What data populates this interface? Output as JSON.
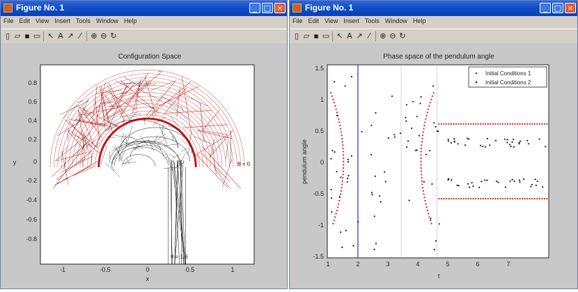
{
  "windows": [
    {
      "title": "Figure No. 1",
      "menu": [
        "File",
        "Edit",
        "View",
        "Insert",
        "Tools",
        "Window",
        "Help"
      ],
      "plot": {
        "title": "Configuration Space",
        "xlabel": "x",
        "ylabel": "y",
        "x_ticks": [
          "-1",
          "-0.5",
          "0",
          "0.5",
          "1"
        ],
        "y_ticks": [
          "0.8",
          "0.6",
          "0.4",
          "0.2",
          "0",
          "-0.2",
          "-0.4",
          "-0.6",
          "-0.8"
        ],
        "annotation_top": "θ = 0",
        "annotation_bottom": "θ = 1.6"
      }
    },
    {
      "title": "Figure No. 1",
      "menu": [
        "File",
        "Edit",
        "View",
        "Insert",
        "Tools",
        "Window",
        "Help"
      ],
      "plot": {
        "title": "Phase space of the pendulum angle",
        "xlabel": "t",
        "ylabel": "pendulum angle",
        "x_ticks": [
          "1",
          "2",
          "3",
          "4",
          "5",
          "6",
          "7"
        ],
        "y_ticks": [
          "1.5",
          "1",
          "0.5",
          "0",
          "-0.5",
          "-1",
          "-1.5"
        ],
        "legend": [
          "Initial Conditions 1",
          "Initial Conditions 2"
        ],
        "series_colors": [
          "#d81818",
          "#1a1a1a"
        ]
      }
    }
  ],
  "window_buttons": {
    "minimize": "_",
    "maximize": "□",
    "close": "×"
  },
  "icons": [
    "new-icon",
    "open-icon",
    "save-icon",
    "print-icon",
    "arrow-icon",
    "text-icon",
    "line-arrow-icon",
    "line-icon",
    "zoom-in-icon",
    "zoom-out-icon",
    "rotate-icon"
  ],
  "chart_data": [
    {
      "type": "line",
      "title": "Configuration Space",
      "xlabel": "x",
      "ylabel": "y",
      "xlim": [
        -1.1,
        1.1
      ],
      "ylim": [
        -0.9,
        0.95
      ],
      "grid": false,
      "series": [
        {
          "color": "#c81414",
          "shape": "semicircle band",
          "r_inner": 0.5,
          "r_outer": 1.0
        },
        {
          "color": "#111111",
          "shape": "pendulum trajectory traces"
        }
      ]
    },
    {
      "type": "scatter",
      "title": "Phase space of the pendulum angle",
      "xlabel": "t",
      "ylabel": "pendulum angle",
      "xlim": [
        0.95,
        7.1
      ],
      "ylim": [
        -1.55,
        1.55
      ],
      "legend": "top-right",
      "series": [
        {
          "name": "Initial Conditions 1",
          "color": "#d81818"
        },
        {
          "name": "Initial Conditions 2",
          "color": "#1a1a1a"
        }
      ]
    }
  ]
}
